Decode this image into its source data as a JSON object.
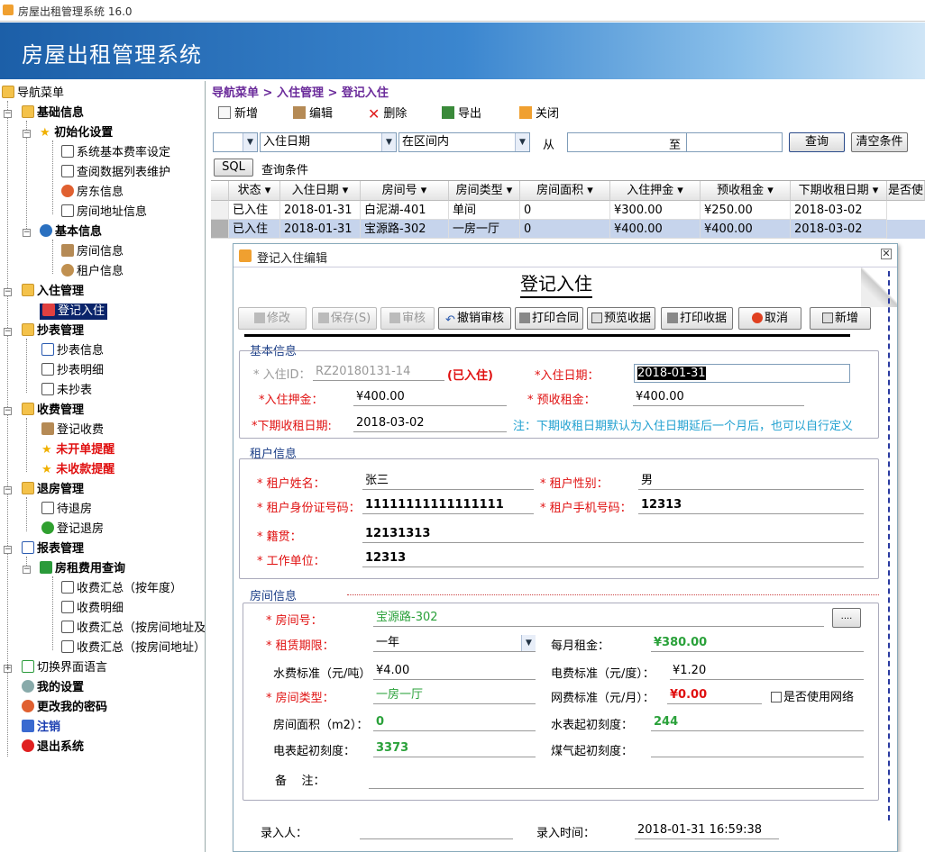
{
  "window": {
    "title": "房屋出租管理系统 16.0"
  },
  "banner": {
    "title": "房屋出租管理系统"
  },
  "sidebar": {
    "root": "导航菜单",
    "basic": "基础信息",
    "init": "初始化设置",
    "fee_setting": "系统基本费率设定",
    "lookup": "查阅数据列表维护",
    "landlord": "房东信息",
    "address": "房间地址信息",
    "basic_info": "基本信息",
    "room_info": "房间信息",
    "tenant_info": "租户信息",
    "checkin_mgmt": "入住管理",
    "checkin": "登记入住",
    "meter_mgmt": "抄表管理",
    "meter_info": "抄表信息",
    "meter_detail": "抄表明细",
    "meter_pending": "未抄表",
    "fee_mgmt": "收费管理",
    "fee_register": "登记收费",
    "unbilled": "未开单提醒",
    "unpaid": "未收款提醒",
    "checkout_mgmt": "退房管理",
    "pending_checkout": "待退房",
    "checkout": "登记退房",
    "report_mgmt": "报表管理",
    "rent_query": "房租费用查询",
    "sum_year": "收费汇总（按年度）",
    "fee_detail": "收费明细",
    "sum_addr1": "收费汇总（按房间地址及",
    "sum_addr2": "收费汇总（按房间地址）",
    "lang": "切换界面语言",
    "my_settings": "我的设置",
    "change_pwd": "更改我的密码",
    "logout": "注销",
    "exit": "退出系统"
  },
  "main": {
    "breadcrumb": "导航菜单 > 入住管理 > 登记入住",
    "toolbar": {
      "new": "新增",
      "edit": "编辑",
      "delete": "删除",
      "export": "导出",
      "close": "关闭"
    },
    "filter": {
      "field": "入住日期",
      "op": "在区间内",
      "from": "从",
      "to": "至",
      "query": "查询",
      "clear": "清空条件",
      "sql": "SQL",
      "cond": "查询条件"
    },
    "grid": {
      "headers": [
        "状态",
        "入住日期",
        "房间号",
        "房间类型",
        "房间面积",
        "入住押金",
        "预收租金",
        "下期收租日期",
        "是否使"
      ],
      "rows": [
        [
          "已入住",
          "2018-01-31",
          "白泥湖-401",
          "单间",
          "0",
          "¥300.00",
          "¥250.00",
          "2018-03-02"
        ],
        [
          "已入住",
          "2018-01-31",
          "宝源路-302",
          "一房一厅",
          "0",
          "¥400.00",
          "¥400.00",
          "2018-03-02"
        ]
      ]
    }
  },
  "dialog": {
    "title": "登记入住编辑",
    "form_title": "登记入住",
    "buttons": {
      "modify": "修改",
      "save": "保存(S)",
      "audit": "审核",
      "unaudit": "撤销审核",
      "print_contract": "打印合同",
      "preview_receipt": "预览收据",
      "print_receipt": "打印收据",
      "cancel": "取消",
      "new": "新增"
    },
    "basic": {
      "section": "基本信息",
      "id_label": "* 入住ID：",
      "id_value": "RZ20180131-14",
      "status": "(已入住)",
      "date_label": "*入住日期：",
      "date_value": "2018-01-31",
      "deposit_label": "*入住押金：",
      "deposit_value": "¥400.00",
      "prepaid_label": "* 预收租金：",
      "prepaid_value": "¥400.00",
      "next_label": "*下期收租日期:",
      "next_value": "2018-03-02",
      "note": "注：下期收租日期默认为入住日期延后一个月后，也可以自行定义"
    },
    "tenant": {
      "section": "租户信息",
      "name_label": "* 租户姓名：",
      "name_value": "张三",
      "gender_label": "* 租户性别：",
      "gender_value": "男",
      "idno_label": "* 租户身份证号码：",
      "idno_value": "11111111111111111",
      "phone_label": "* 租户手机号码：",
      "phone_value": "12313",
      "origin_label": "* 籍贯：",
      "origin_value": "12131313",
      "work_label": "* 工作单位：",
      "work_value": "12313"
    },
    "room": {
      "section": "房间信息",
      "no_label": "* 房间号：",
      "no_value": "宝源路-302",
      "browse": "....",
      "term_label": "* 租赁期限：",
      "term_value": "一年",
      "rent_label": "每月租金：",
      "rent_value": "¥380.00",
      "water_label": "水费标准（元/吨）",
      "water_value": "¥4.00",
      "elec_label": "电费标准（元/度）：",
      "elec_value": "¥1.20",
      "type_label": "* 房间类型：",
      "type_value": "一房一厅",
      "net_label": "网费标准（元/月）：",
      "net_value": "¥0.00",
      "use_net": "是否使用网络",
      "area_label": "房间面积（m2）：",
      "area_value": "0",
      "water_start_label": "水表起初刻度：",
      "water_start_value": "244",
      "elec_start_label": "电表起初刻度：",
      "elec_start_value": "3373",
      "gas_start_label": "煤气起初刻度：",
      "remark_label": "备    注："
    },
    "footer": {
      "entry_user": "录入人：",
      "entry_time_label": "录入时间：",
      "entry_time_value": "2018-01-31 16:59:38"
    }
  }
}
